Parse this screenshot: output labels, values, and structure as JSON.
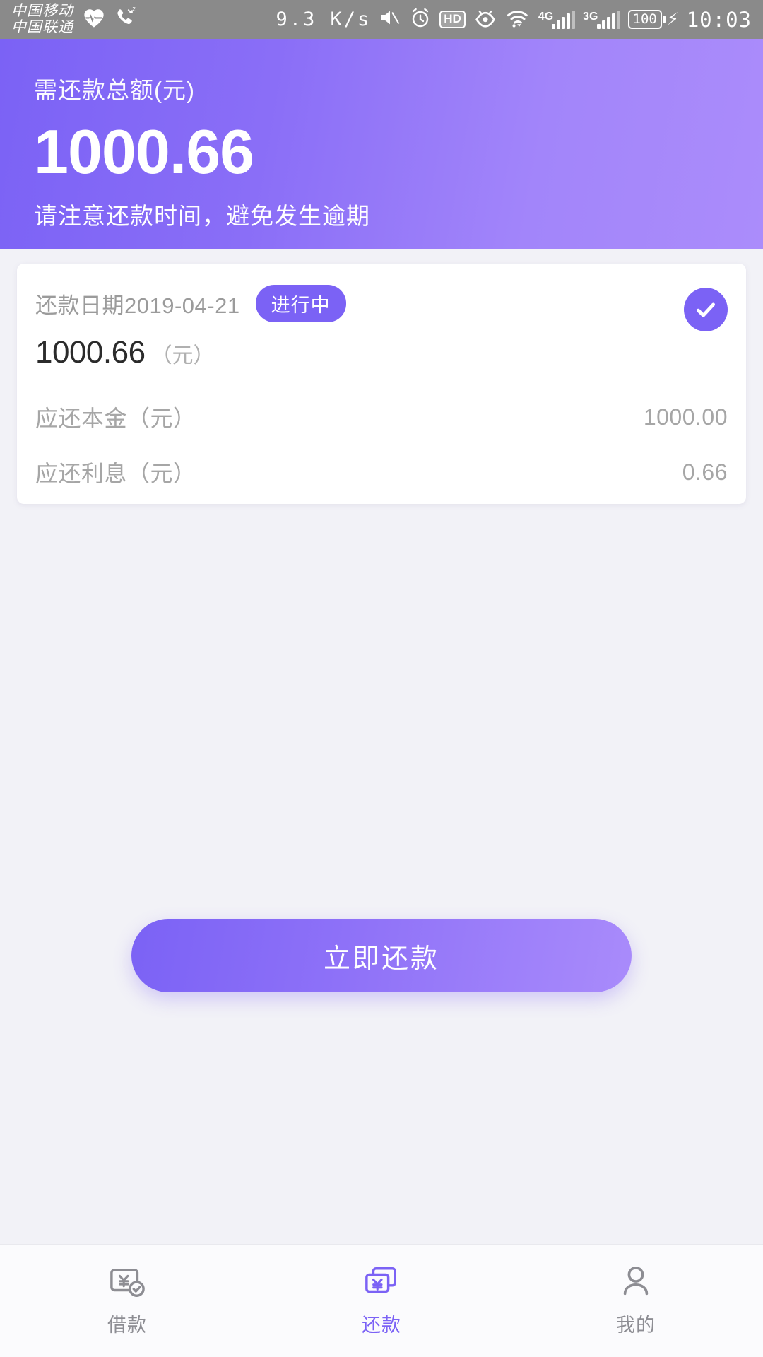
{
  "statusbar": {
    "carrier_1": "中国移动",
    "carrier_2": "中国联通",
    "icons_left": [
      "heartbeat-icon",
      "missed-call-icon"
    ],
    "net_speed": "9.3 K/s",
    "icons_right": [
      "mute-icon",
      "alarm-icon",
      "hd-icon",
      "eye-icon",
      "wifi-icon"
    ],
    "hd_label": "HD",
    "signal_4g_label": "4G",
    "signal_3g_label": "3G",
    "battery_level": "100",
    "charging": true,
    "time": "10:03"
  },
  "header": {
    "label": "需还款总额(元)",
    "amount": "1000.66",
    "note": "请注意还款时间，避免发生逾期",
    "gradient_from": "#7b62f5",
    "gradient_to": "#ab8cfb"
  },
  "card": {
    "date_label": "还款日期2019-04-21",
    "status_badge": "进行中",
    "status_badge_color": "#7b62f5",
    "amount": "1000.66",
    "amount_unit": "（元）",
    "checked": true,
    "details": [
      {
        "label": "应还本金（元）",
        "value": "1000.00"
      },
      {
        "label": "应还利息（元）",
        "value": "0.66"
      }
    ]
  },
  "cta": {
    "label": "立即还款"
  },
  "tabbar": {
    "active_color": "#7b62f5",
    "inactive_color": "#8d8d93",
    "items": [
      {
        "label": "借款",
        "icon": "borrow-money-icon",
        "active": false
      },
      {
        "label": "还款",
        "icon": "repay-money-icon",
        "active": true
      },
      {
        "label": "我的",
        "icon": "user-profile-icon",
        "active": false
      }
    ]
  }
}
